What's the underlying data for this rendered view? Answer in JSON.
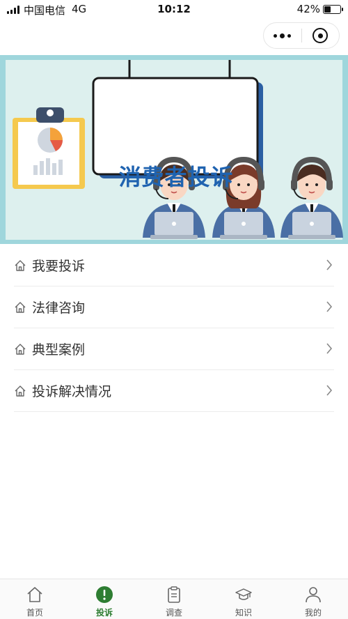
{
  "status_bar": {
    "carrier": "中国电信",
    "network": "4G",
    "time": "10:12",
    "battery_text": "42%",
    "battery_level": 0.42
  },
  "banner": {
    "title": "消费者投诉"
  },
  "menu": {
    "items": [
      {
        "label": "我要投诉",
        "icon": "home-icon"
      },
      {
        "label": "法律咨询",
        "icon": "home-icon"
      },
      {
        "label": "典型案例",
        "icon": "home-icon"
      },
      {
        "label": "投诉解决情况",
        "icon": "home-icon"
      }
    ]
  },
  "tabbar": {
    "items": [
      {
        "label": "首页",
        "icon": "home-icon",
        "active": false
      },
      {
        "label": "投诉",
        "icon": "exclamation-icon",
        "active": true
      },
      {
        "label": "调查",
        "icon": "clipboard-icon",
        "active": false
      },
      {
        "label": "知识",
        "icon": "graduation-cap-icon",
        "active": false
      },
      {
        "label": "我的",
        "icon": "person-icon",
        "active": false
      }
    ]
  },
  "colors": {
    "accent": "#2e7d32",
    "banner_border": "#9fd6dc",
    "banner_title": "#1f63b0"
  }
}
